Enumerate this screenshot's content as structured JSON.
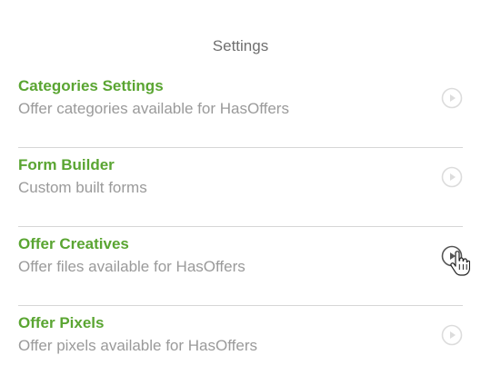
{
  "header": {
    "title": "Settings"
  },
  "items": [
    {
      "title": "Categories Settings",
      "subtitle": "Offer categories available for HasOffers",
      "icon": "play-circle-icon",
      "active": false
    },
    {
      "title": "Form Builder",
      "subtitle": "Custom built forms",
      "icon": "play-circle-icon",
      "active": false
    },
    {
      "title": "Offer Creatives",
      "subtitle": "Offer files available for HasOffers",
      "icon": "play-circle-icon",
      "active": true
    },
    {
      "title": "Offer Pixels",
      "subtitle": "Offer pixels available for HasOffers",
      "icon": "play-circle-icon",
      "active": false
    }
  ],
  "colors": {
    "title_green": "#5aa532",
    "subtitle_gray": "#9a9a9a",
    "icon_inactive": "#dcdcdc",
    "icon_active": "#555555",
    "divider": "#d6d6d6"
  }
}
